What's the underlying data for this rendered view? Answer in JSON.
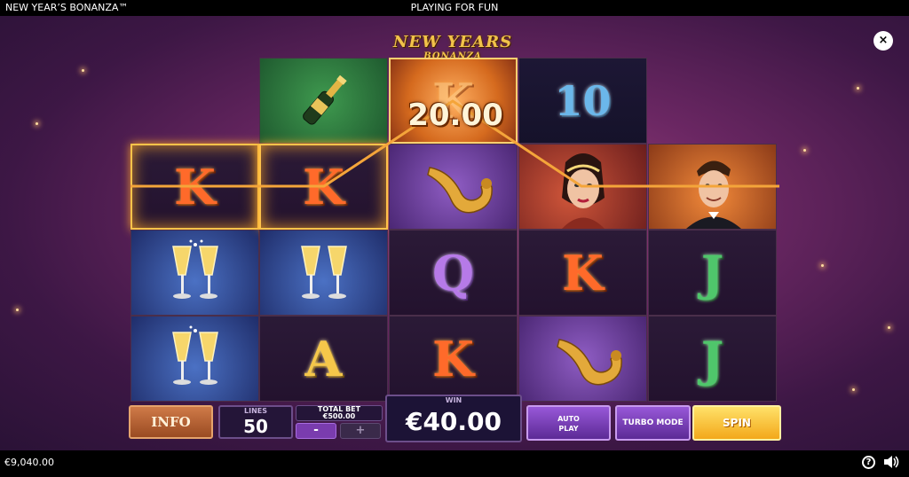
{
  "topbar": {
    "game_title": "NEW YEAR’S BONANZA™",
    "mode": "PLAYING FOR FUN"
  },
  "close_button": {
    "label": "×"
  },
  "logo": {
    "line1": "NEW YEARS",
    "line2": "BONANZA"
  },
  "reels": {
    "win_line_amount": "20.00",
    "symbols": [
      [
        "K",
        "champagne-glasses",
        "champagne-glasses"
      ],
      [
        "champagne-bottle",
        "K",
        "champagne-glasses",
        "A"
      ],
      [
        "K",
        "saxophone",
        "Q",
        "K"
      ],
      [
        "10",
        "lady",
        "K",
        "saxophone"
      ],
      [
        "man",
        "J",
        "J"
      ]
    ]
  },
  "controls": {
    "info_label": "INFO",
    "lines_label": "LINES",
    "lines_value": "50",
    "total_bet_label": "TOTAL BET",
    "total_bet_value": "€500.00",
    "minus_label": "-",
    "plus_label": "+",
    "win_label": "WIN",
    "win_value": "€40.00",
    "autoplay_line1": "AUTO",
    "autoplay_line2": "PLAY",
    "turbo_label": "TURBO MODE",
    "spin_label": "SPIN"
  },
  "bottombar": {
    "balance": "€9,040.00"
  },
  "icons": {
    "help": "help-icon",
    "sound": "sound-icon",
    "close": "close-icon"
  }
}
